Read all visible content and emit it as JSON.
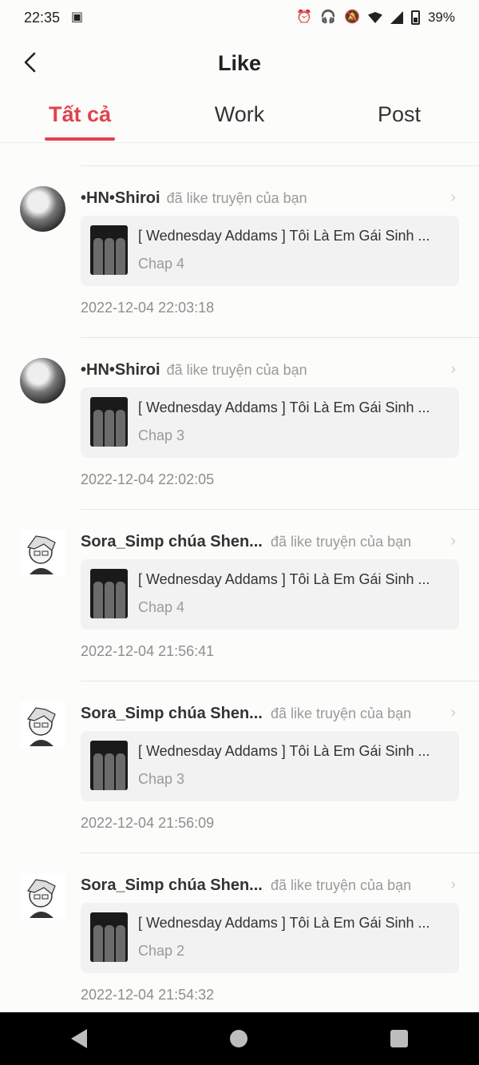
{
  "status_bar": {
    "time": "22:35",
    "battery": "39%",
    "icons": [
      "sim-icon",
      "alarm-icon",
      "headphones-icon",
      "mute-icon",
      "wifi-icon",
      "signal-icon",
      "battery-icon"
    ]
  },
  "header": {
    "title": "Like",
    "back_icon": "chevron-left-icon"
  },
  "tabs": [
    {
      "label": "Tất cả",
      "active": true
    },
    {
      "label": "Work",
      "active": false
    },
    {
      "label": "Post",
      "active": false
    }
  ],
  "accent_color": "#e0434c",
  "notifications": [
    {
      "user": "•HN•Shiroi",
      "action": "đã like truyện của bạn",
      "story_title": "[ Wednesday Addams ] Tôi Là Em Gái Sinh ...",
      "chapter": "Chap 4",
      "time": "2022-12-04 22:03:18"
    },
    {
      "user": "•HN•Shiroi",
      "action": "đã like truyện của bạn",
      "story_title": "[ Wednesday Addams ] Tôi Là Em Gái Sinh ...",
      "chapter": "Chap 3",
      "time": "2022-12-04 22:02:05"
    },
    {
      "user": "Sora_Simp chúa Shen...",
      "action": "đã like truyện của bạn",
      "story_title": "[ Wednesday Addams ] Tôi Là Em Gái Sinh ...",
      "chapter": "Chap 4",
      "time": "2022-12-04 21:56:41"
    },
    {
      "user": "Sora_Simp chúa Shen...",
      "action": "đã like truyện của bạn",
      "story_title": "[ Wednesday Addams ] Tôi Là Em Gái Sinh ...",
      "chapter": "Chap 3",
      "time": "2022-12-04 21:56:09"
    },
    {
      "user": "Sora_Simp chúa Shen...",
      "action": "đã like truyện của bạn",
      "story_title": "[ Wednesday Addams ] Tôi Là Em Gái Sinh ...",
      "chapter": "Chap 2",
      "time": "2022-12-04 21:54:32"
    }
  ]
}
